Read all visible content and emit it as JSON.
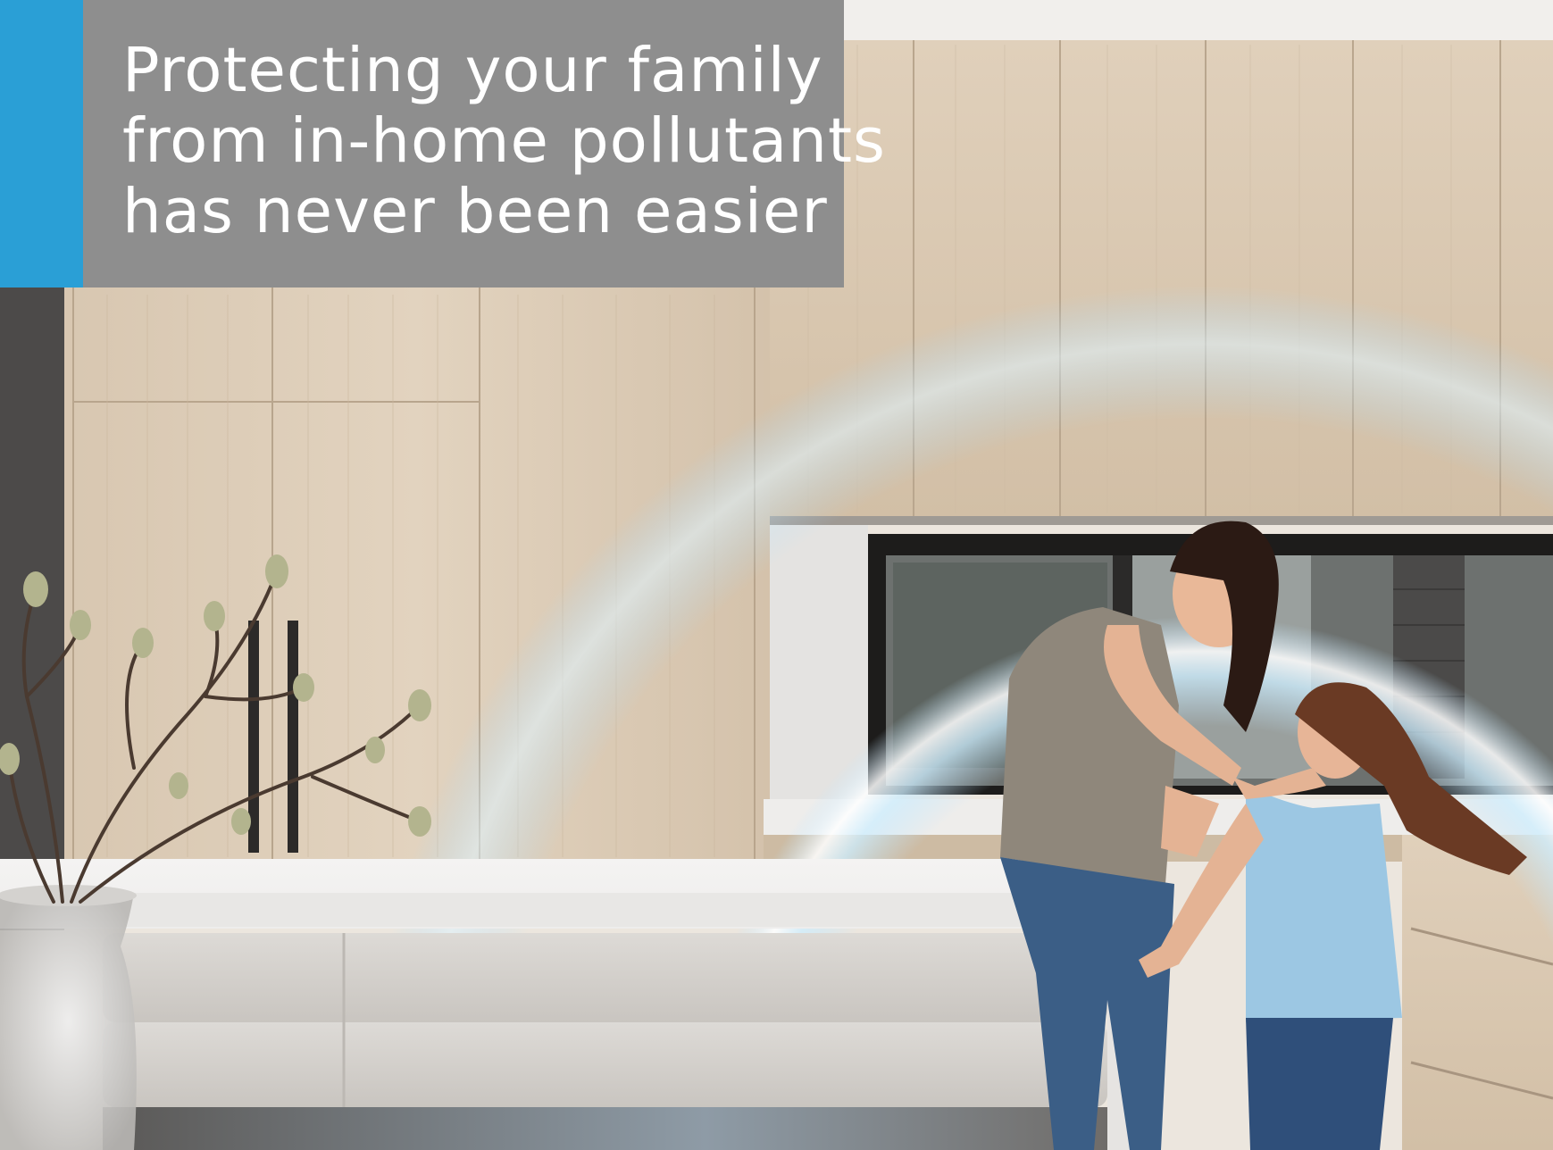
{
  "headline": {
    "lines": [
      "Protecting your family",
      "from in-home pollutants",
      "has never been easier"
    ]
  },
  "colors": {
    "accent_bar": "#2a9fd6",
    "headline_panel": "#8e8e8e",
    "headline_text": "#ffffff",
    "cabinet_wood": "#d9c8b3",
    "air_glow": "#bfe6ff"
  },
  "scene": {
    "description_elements": [
      "kitchen-cabinets",
      "marble-island",
      "window",
      "woman",
      "girl",
      "vase-with-branches",
      "air-glow-arc"
    ]
  }
}
